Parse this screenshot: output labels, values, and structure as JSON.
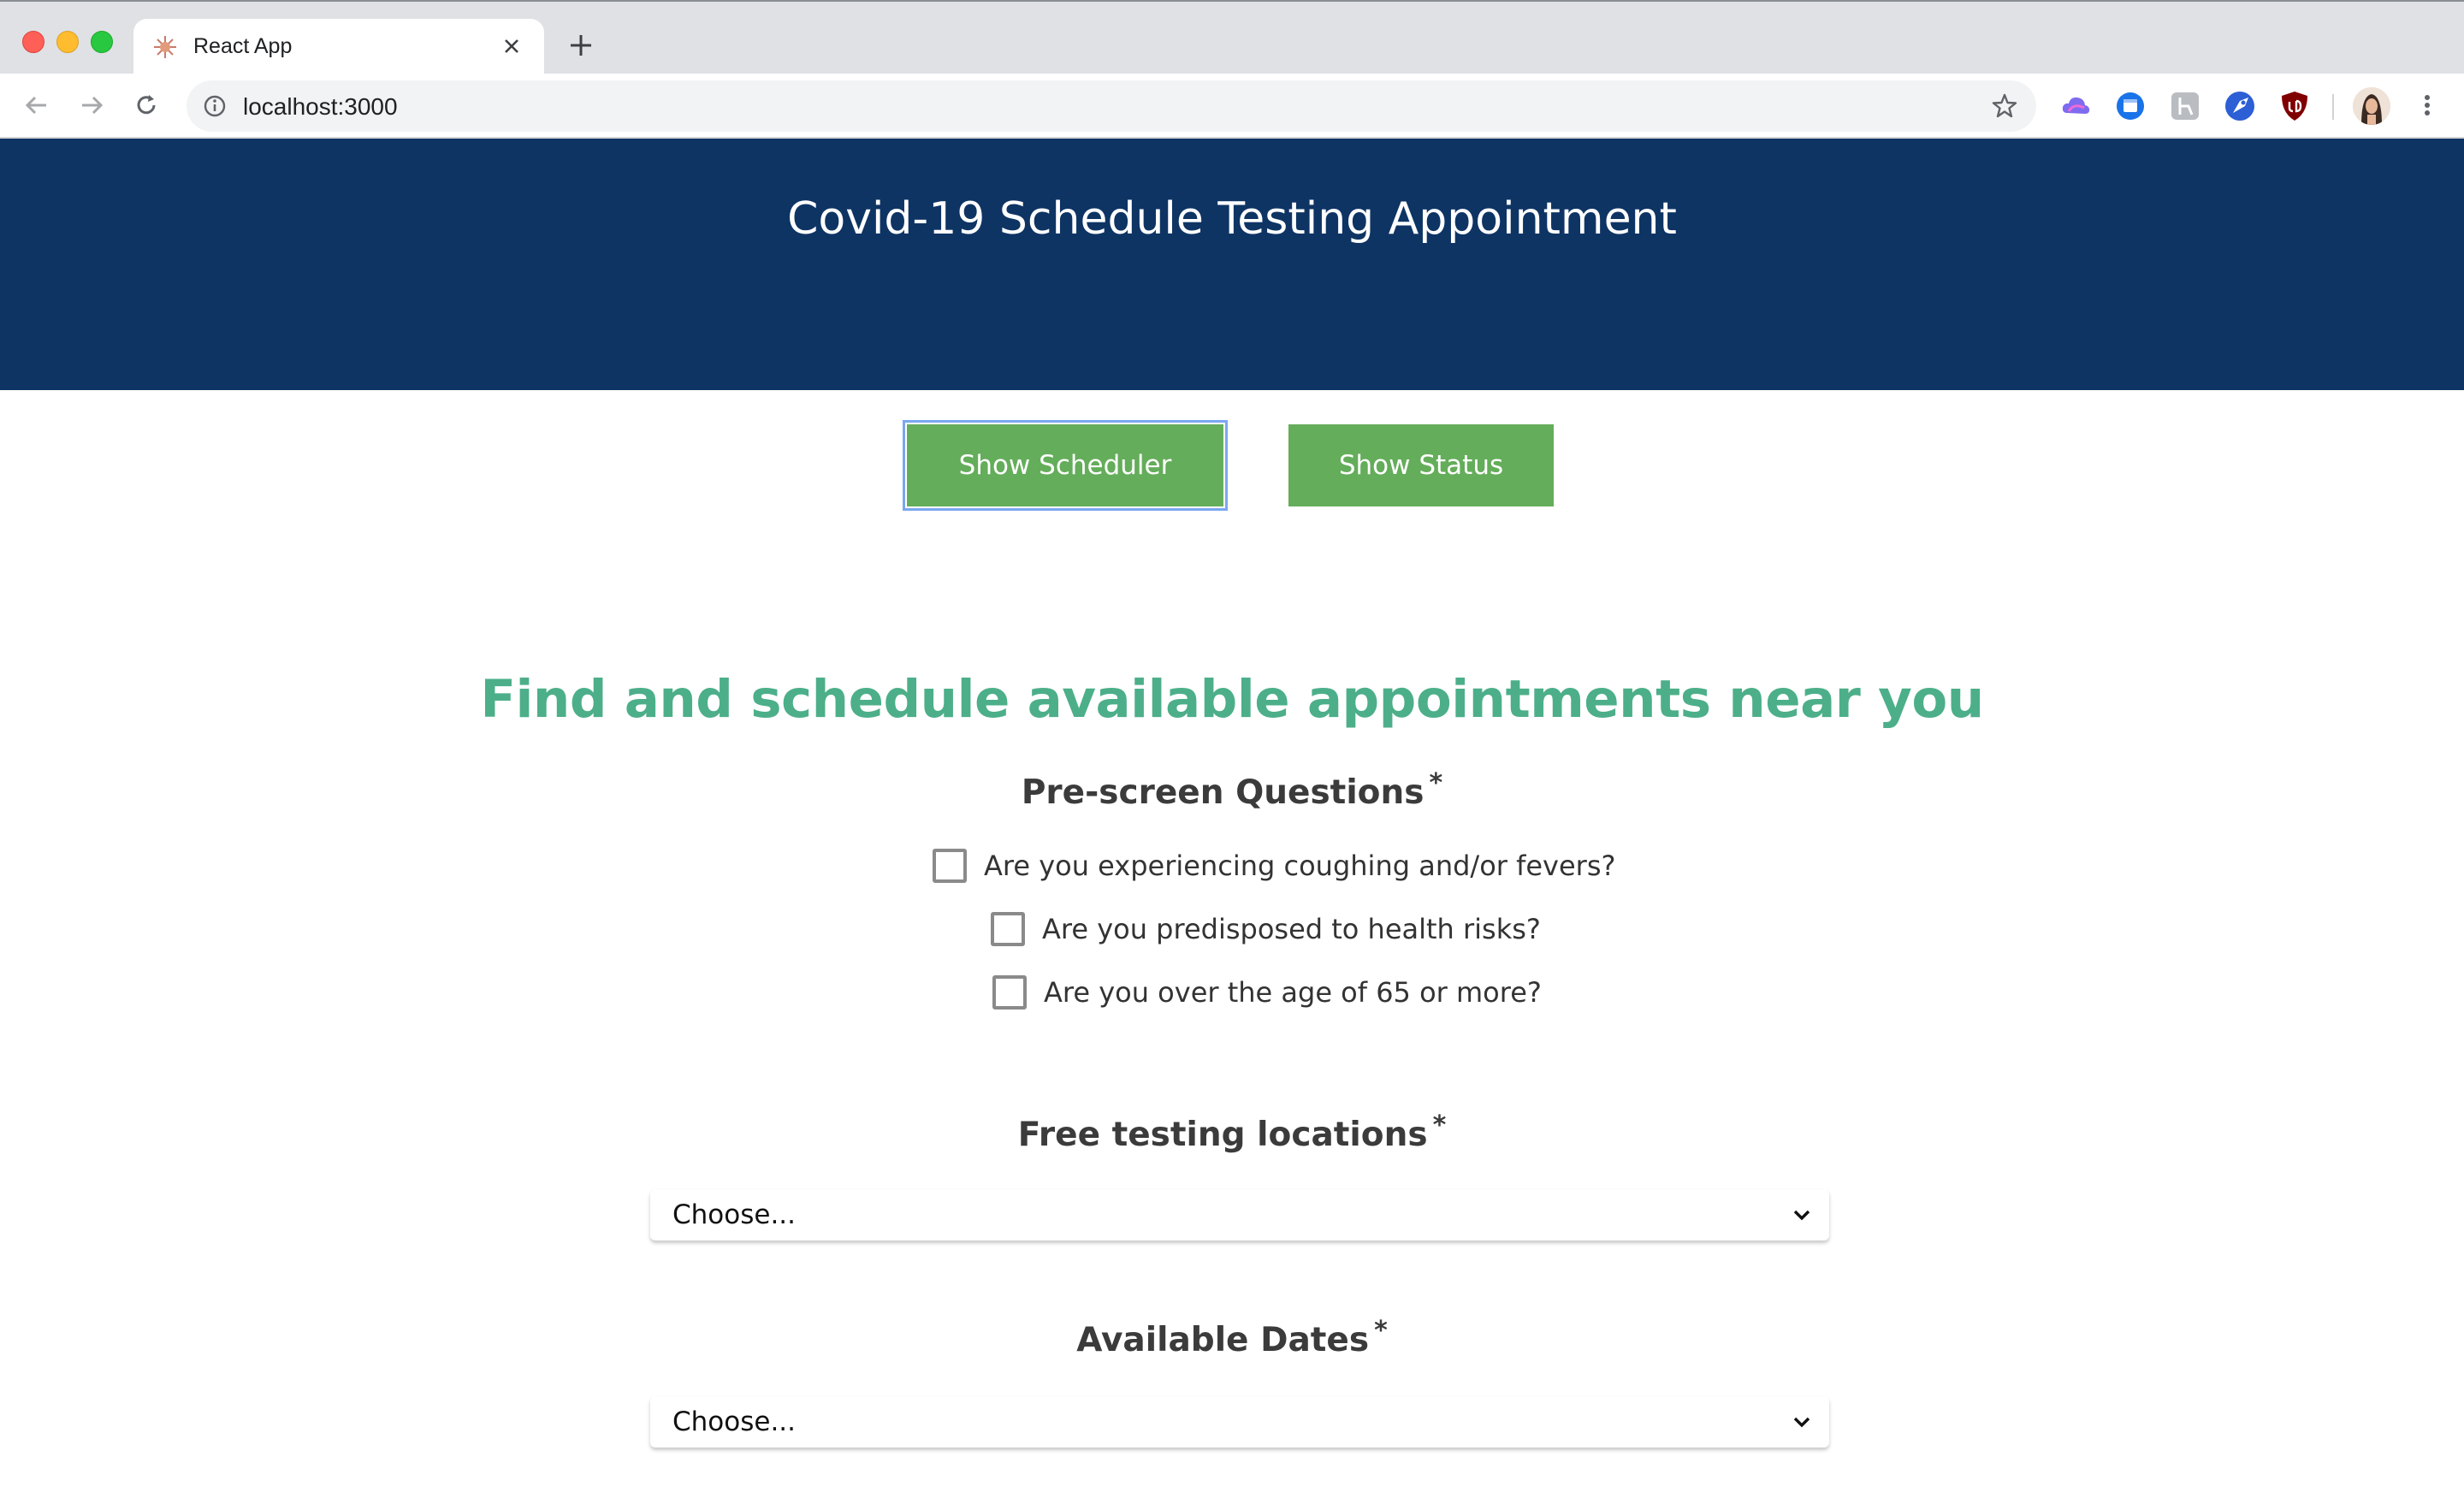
{
  "browser": {
    "tab_title": "React App",
    "new_tab_symbol": "+",
    "url": "localhost:3000"
  },
  "header": {
    "title": "Covid-19 Schedule Testing Appointment",
    "background": "#0e3464"
  },
  "nav_buttons": {
    "scheduler_label": "Show Scheduler",
    "status_label": "Show Status",
    "color": "#64ad5a"
  },
  "main": {
    "headline": "Find and schedule available appointments near you",
    "headline_color": "#4caf8a",
    "prescreen": {
      "title": "Pre-screen Questions",
      "required_mark": "*",
      "questions": [
        {
          "label": "Are you experiencing coughing and/or fevers?",
          "checked": false
        },
        {
          "label": "Are you predisposed to health risks?",
          "checked": false
        },
        {
          "label": "Are you over the age of 65 or more?",
          "checked": false
        }
      ]
    },
    "locations": {
      "title": "Free testing locations",
      "required_mark": "*",
      "selected": "Choose..."
    },
    "dates": {
      "title": "Available Dates",
      "required_mark": "*",
      "selected": "Choose..."
    }
  }
}
